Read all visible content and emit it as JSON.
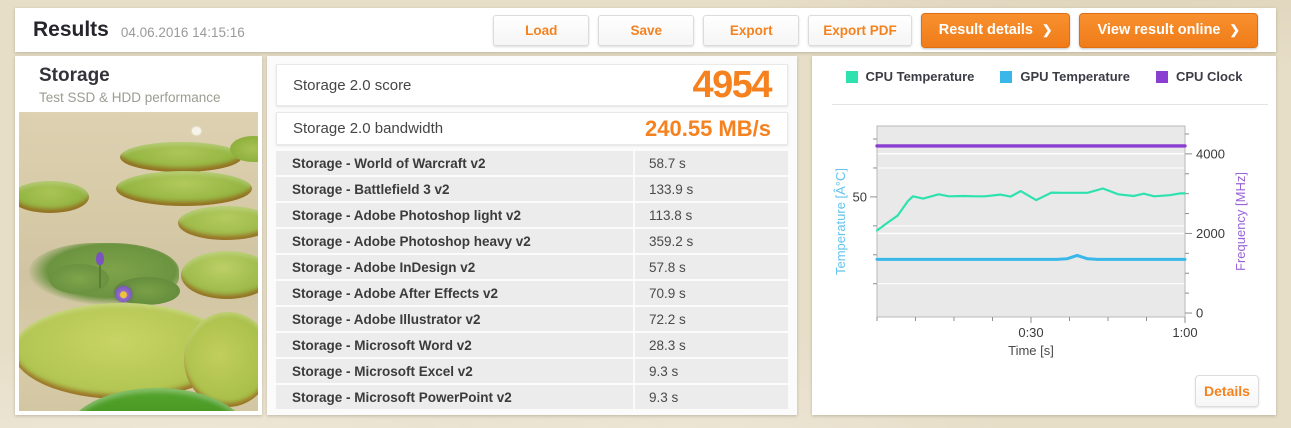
{
  "colors": {
    "accent_orange": "#f5821f",
    "cpu_temp": "#2ee2af",
    "gpu_temp": "#39b7e9",
    "cpu_clock": "#8b3fd1",
    "row_bg": "#ececec",
    "page_bg": "#e7dec8"
  },
  "header": {
    "title": "Results",
    "timestamp": "04.06.2016 14:15:16",
    "secondary_buttons": [
      "Load",
      "Save",
      "Export",
      "Export PDF"
    ],
    "primary_buttons": [
      "Result details",
      "View result online"
    ],
    "chevron": "❯"
  },
  "left_panel": {
    "title": "Storage",
    "subtitle": "Test SSD & HDD performance",
    "photo_alt": "water-lily-pads-photo"
  },
  "score_panel": {
    "score_label": "Storage 2.0 score",
    "score_value": "4954",
    "bandwidth_label": "Storage 2.0 bandwidth",
    "bandwidth_value": "240.55 MB/s",
    "rows": [
      {
        "label": "Storage - World of Warcraft v2",
        "value": "58.7 s"
      },
      {
        "label": "Storage - Battlefield 3 v2",
        "value": "133.9 s"
      },
      {
        "label": "Storage - Adobe Photoshop light v2",
        "value": "113.8 s"
      },
      {
        "label": "Storage - Adobe Photoshop heavy v2",
        "value": "359.2 s"
      },
      {
        "label": "Storage - Adobe InDesign v2",
        "value": "57.8 s"
      },
      {
        "label": "Storage - Adobe After Effects v2",
        "value": "70.9 s"
      },
      {
        "label": "Storage - Adobe Illustrator v2",
        "value": "72.2 s"
      },
      {
        "label": "Storage - Microsoft Word v2",
        "value": "28.3 s"
      },
      {
        "label": "Storage - Microsoft Excel v2",
        "value": "9.3 s"
      },
      {
        "label": "Storage - Microsoft PowerPoint v2",
        "value": "9.3 s"
      }
    ]
  },
  "chart_panel": {
    "details_label": "Details"
  },
  "chart_data": {
    "type": "line",
    "title": "",
    "plot_bg": "#e9e9e9",
    "grid": true,
    "legend_position": "top",
    "x_axis": {
      "title": "Time [s]",
      "range": [
        0,
        60
      ],
      "major_ticks": [
        {
          "v": 30,
          "label": "0:30"
        },
        {
          "v": 60,
          "label": "1:00"
        }
      ],
      "minor_ticks": [
        0,
        7.5,
        15,
        22.5,
        37.5,
        45,
        52.5
      ]
    },
    "left_axis": {
      "title": "Temperature [Â°C]",
      "title_color": "#66c3ee",
      "range": [
        8.5,
        74.5
      ],
      "major_ticks": [
        {
          "v": 50,
          "label": "50"
        }
      ],
      "minor_ticks": [
        20,
        30,
        40,
        60,
        70
      ],
      "gridlines": [
        20,
        40,
        60
      ]
    },
    "right_axis": {
      "title": "Frequency [MHz]",
      "title_color": "#9a63d8",
      "range": [
        -100,
        4700
      ],
      "major_ticks": [
        {
          "v": 0,
          "label": "0"
        },
        {
          "v": 2000,
          "label": "2000"
        },
        {
          "v": 4000,
          "label": "4000"
        }
      ],
      "minor_ticks": [
        500,
        1000,
        1500,
        2500,
        3000,
        3500,
        4500
      ],
      "gridlines": [
        2000,
        4000
      ]
    },
    "series": [
      {
        "name": "CPU Temperature",
        "color": "#2ee2af",
        "axis": "left",
        "width": 2.2,
        "points": [
          [
            0,
            38.4
          ],
          [
            2,
            41
          ],
          [
            4,
            43.5
          ],
          [
            6,
            48.5
          ],
          [
            7,
            50.2
          ],
          [
            9,
            49.4
          ],
          [
            12,
            50.9
          ],
          [
            14,
            50.2
          ],
          [
            17,
            50.3
          ],
          [
            19,
            50.2
          ],
          [
            21,
            50.2
          ],
          [
            24,
            50.8
          ],
          [
            26,
            50.1
          ],
          [
            28,
            52.0
          ],
          [
            31,
            48.9
          ],
          [
            34,
            51.5
          ],
          [
            36,
            51.4
          ],
          [
            39,
            51.4
          ],
          [
            41,
            51.4
          ],
          [
            44,
            52.9
          ],
          [
            47,
            50.9
          ],
          [
            50,
            50.3
          ],
          [
            52,
            51.1
          ],
          [
            54,
            50.2
          ],
          [
            57,
            50.6
          ],
          [
            59,
            51.2
          ],
          [
            60,
            51.2
          ]
        ]
      },
      {
        "name": "GPU Temperature",
        "color": "#39b7e9",
        "axis": "left",
        "width": 3,
        "points": [
          [
            0,
            28.4
          ],
          [
            35,
            28.4
          ],
          [
            37,
            28.6
          ],
          [
            39,
            29.8
          ],
          [
            41,
            28.6
          ],
          [
            43,
            28.4
          ],
          [
            60,
            28.4
          ]
        ]
      },
      {
        "name": "CPU Clock",
        "color": "#8b3fd1",
        "axis": "right",
        "width": 3.4,
        "points": [
          [
            0,
            4200
          ],
          [
            60,
            4200
          ]
        ]
      }
    ]
  }
}
